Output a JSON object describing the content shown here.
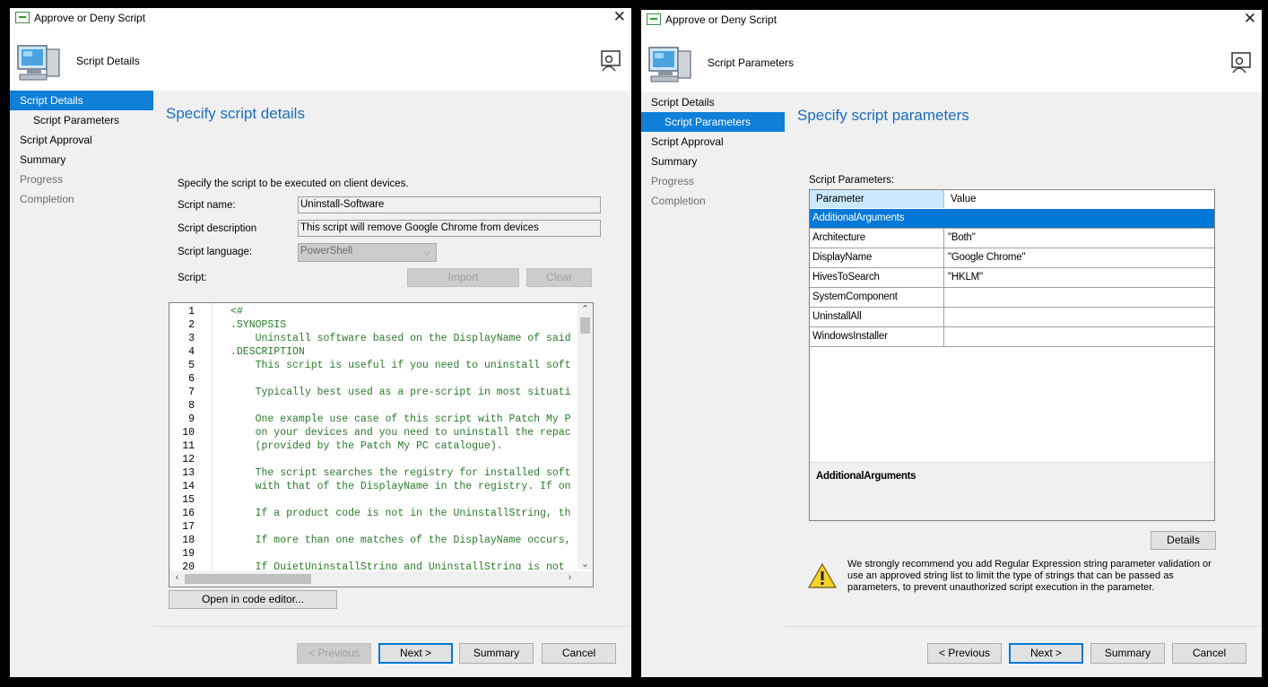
{
  "left_window": {
    "title": "Approve or Deny Script",
    "header_title": "Script Details",
    "nav": [
      {
        "label": "Script Details",
        "state": "selected"
      },
      {
        "label": "Script Parameters",
        "state": "normal"
      },
      {
        "label": "Script Approval",
        "state": "normal"
      },
      {
        "label": "Summary",
        "state": "normal"
      },
      {
        "label": "Progress",
        "state": "disabled"
      },
      {
        "label": "Completion",
        "state": "disabled"
      }
    ],
    "page_title": "Specify script details",
    "intro": "Specify the script to be executed on client devices.",
    "script_name_label": "Script name:",
    "script_name_value": "Uninstall-Software",
    "script_description_label": "Script description",
    "script_description_value": "This script will remove Google Chrome from devices",
    "script_language_label": "Script language:",
    "script_language_value": "PowerShell",
    "script_label": "Script:",
    "import_label": "Import",
    "clear_label": "Clear",
    "code_lines": [
      {
        "n": "1",
        "text": "<#"
      },
      {
        "n": "2",
        "text": ".SYNOPSIS"
      },
      {
        "n": "3",
        "text": "    Uninstall software based on the DisplayName of said"
      },
      {
        "n": "4",
        "text": ".DESCRIPTION"
      },
      {
        "n": "5",
        "text": "    This script is useful if you need to uninstall soft"
      },
      {
        "n": "6",
        "text": ""
      },
      {
        "n": "7",
        "text": "    Typically best used as a pre-script in most situati"
      },
      {
        "n": "8",
        "text": ""
      },
      {
        "n": "9",
        "text": "    One example use case of this script with Patch My P"
      },
      {
        "n": "10",
        "text": "    on your devices and you need to uninstall the repac"
      },
      {
        "n": "11",
        "text": "    (provided by the Patch My PC catalogue)."
      },
      {
        "n": "12",
        "text": ""
      },
      {
        "n": "13",
        "text": "    The script searches the registry for installed soft"
      },
      {
        "n": "14",
        "text": "    with that of the DisplayName in the registry. If on"
      },
      {
        "n": "15",
        "text": ""
      },
      {
        "n": "16",
        "text": "    If a product code is not in the UninstallString, th"
      },
      {
        "n": "17",
        "text": ""
      },
      {
        "n": "18",
        "text": "    If more than one matches of the DisplayName occurs,"
      },
      {
        "n": "19",
        "text": ""
      },
      {
        "n": "20",
        "text": "    If QuietUninstallString and UninstallString is not"
      }
    ],
    "open_editor_label": "Open in code editor...",
    "buttons": {
      "previous": "< Previous",
      "next": "Next >",
      "summary": "Summary",
      "cancel": "Cancel"
    }
  },
  "right_window": {
    "title": "Approve or Deny Script",
    "header_title": "Script Parameters",
    "nav": [
      {
        "label": "Script Details",
        "state": "normal"
      },
      {
        "label": "Script Parameters",
        "state": "selected"
      },
      {
        "label": "Script Approval",
        "state": "normal"
      },
      {
        "label": "Summary",
        "state": "normal"
      },
      {
        "label": "Progress",
        "state": "disabled"
      },
      {
        "label": "Completion",
        "state": "disabled"
      }
    ],
    "page_title": "Specify script parameters",
    "params_label": "Script Parameters:",
    "columns": [
      "Parameter",
      "Value"
    ],
    "rows": [
      {
        "name": "AdditionalArguments",
        "value": ""
      },
      {
        "name": "Architecture",
        "value": "\"Both\""
      },
      {
        "name": "DisplayName",
        "value": "\"Google Chrome\""
      },
      {
        "name": "HivesToSearch",
        "value": "\"HKLM\""
      },
      {
        "name": "SystemComponent",
        "value": ""
      },
      {
        "name": "UninstallAll",
        "value": ""
      },
      {
        "name": "WindowsInstaller",
        "value": ""
      }
    ],
    "selected_param": "AdditionalArguments",
    "details_label": "Details",
    "warning": "We strongly recommend you add Regular Expression string parameter validation or use an approved string list to limit the type of strings that can be passed as parameters, to prevent unauthorized script execution in the parameter.",
    "buttons": {
      "previous": "< Previous",
      "next": "Next >",
      "summary": "Summary",
      "cancel": "Cancel"
    }
  },
  "colors": {
    "selection": "#0078d7",
    "title_blue": "#1a6dc0",
    "code_green": "#2a7a2a"
  }
}
